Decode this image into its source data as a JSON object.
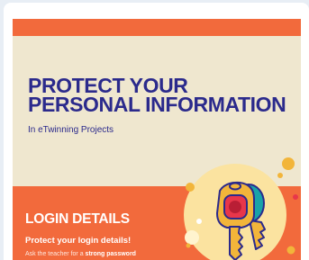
{
  "slide": {
    "title_line1": "PROTECT YOUR",
    "title_line2": "PERSONAL INFORMATION",
    "subtitle": "In eTwinning Projects",
    "section_title": "LOGIN DETAILS",
    "section_subtitle": "Protect your login details!",
    "body_prefix": "Ask the teacher for a",
    "body_bold": "strong password"
  },
  "colors": {
    "accent_orange": "#f26a3c",
    "cream": "#efe7cf",
    "navy": "#2b2a8c",
    "circle_yellow": "#fbe3a0",
    "key_gold": "#f2b53a",
    "key_teal": "#1aa3a8",
    "key_red": "#e8364a"
  },
  "icons": [
    "key-icon",
    "decorative-dot"
  ]
}
